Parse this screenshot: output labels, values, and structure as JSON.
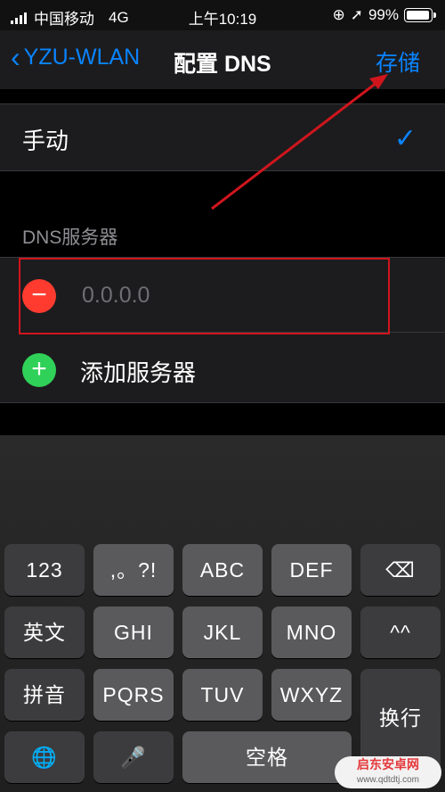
{
  "status": {
    "carrier": "中国移动",
    "network": "4G",
    "time": "上午10:19",
    "battery": "99%"
  },
  "nav": {
    "back": "YZU-WLAN",
    "title": "配置 DNS",
    "save": "存储"
  },
  "mode": {
    "label": "手动",
    "checked": true
  },
  "dns": {
    "header": "DNS服务器",
    "placeholder": "0.0.0.0",
    "add": "添加服务器"
  },
  "keyboard": {
    "row1": [
      "123",
      ",。?!",
      "ABC",
      "DEF",
      "⌫"
    ],
    "row2": [
      "英文",
      "GHI",
      "JKL",
      "MNO",
      "^^"
    ],
    "row3": [
      "拼音",
      "PQRS",
      "TUV",
      "WXYZ",
      "换行"
    ],
    "row4": [
      "🌐",
      "🎤",
      "空格"
    ]
  },
  "watermark": {
    "name": "启东安卓网",
    "url": "www.qdtdtj.com"
  },
  "colors": {
    "accent": "#0a84ff",
    "delete": "#ff3b30",
    "add": "#30d158",
    "annotation": "#d0151d"
  }
}
